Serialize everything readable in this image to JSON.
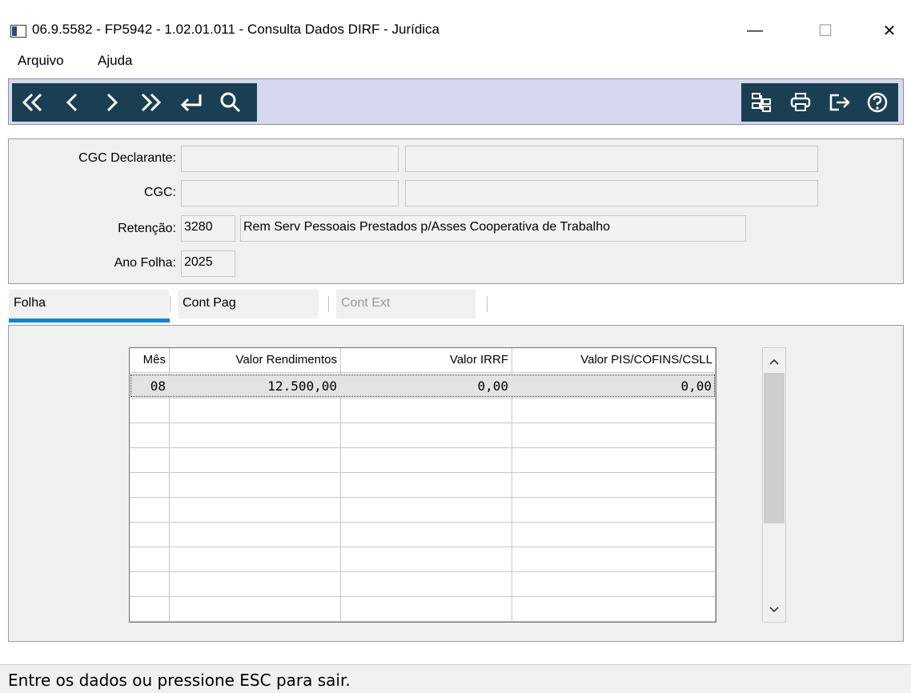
{
  "window": {
    "title": "06.9.5582 - FP5942 - 1.02.01.011 - Consulta Dados DIRF - Jurídica",
    "minimize": "—",
    "maximize": "☐",
    "close": "✕"
  },
  "menu": [
    "Arquivo",
    "Ajuda"
  ],
  "toolbar": {
    "left_icons": [
      "first-record-icon",
      "previous-record-icon",
      "next-record-icon",
      "last-record-icon",
      "enter-icon",
      "search-icon"
    ],
    "right_icons": [
      "tree-structure-icon",
      "print-icon",
      "exit-icon",
      "help-icon"
    ],
    "accent": "#1b3f52",
    "background": "#d5d8ee"
  },
  "form": {
    "cgc_declarante_label": "CGC Declarante:",
    "cgc_declarante_value": "",
    "cgc_declarante_name": "",
    "cgc_label": "CGC:",
    "cgc_value": "",
    "cgc_name": "",
    "retencao_label": "Retenção:",
    "retencao_code": "3280",
    "retencao_desc": "Rem Serv Pessoais Prestados p/Asses Cooperativa de Trabalho",
    "ano_folha_label": "Ano Folha:",
    "ano_folha_value": "2025"
  },
  "tabs": [
    {
      "label": "Folha",
      "active": true
    },
    {
      "label": "Cont Pag",
      "active": false
    },
    {
      "label": "Cont Ext",
      "active": false,
      "disabled": true
    }
  ],
  "grid": {
    "columns": [
      "Mês",
      "Valor Rendimentos",
      "Valor IRRF",
      "Valor PIS/COFINS/CSLL"
    ],
    "rows": [
      [
        "08",
        "12.500,00",
        "0,00",
        "0,00"
      ]
    ]
  },
  "status": {
    "text": "Entre os dados ou pressione ESC para sair."
  }
}
